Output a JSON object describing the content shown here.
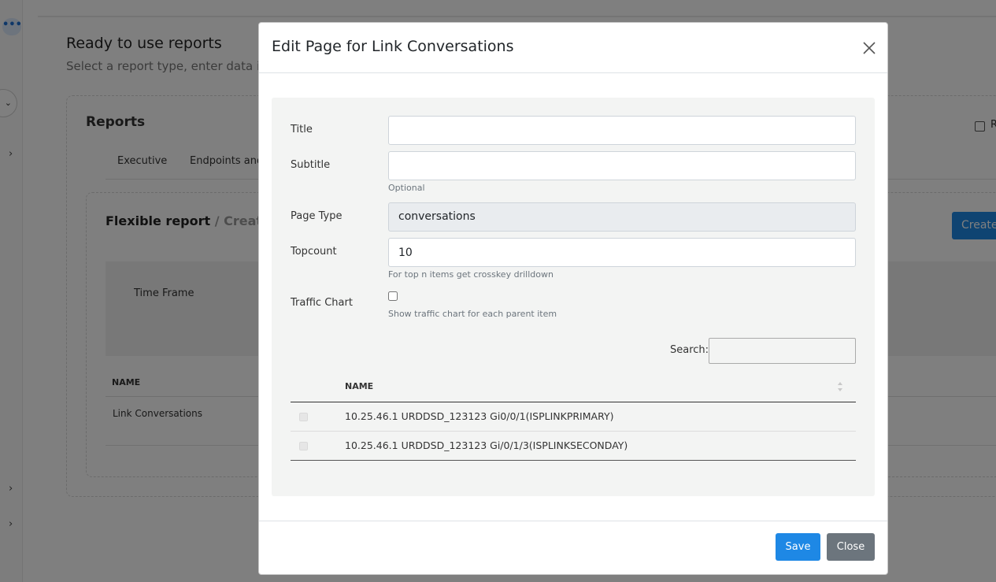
{
  "background": {
    "page_title": "Ready to use reports",
    "page_subtitle": "Select a report type, enter data if r",
    "reports_heading": "Reports",
    "reports_checkbox_label": "R",
    "tabs": [
      "Executive",
      "Endpoints and"
    ],
    "flexible_report": {
      "title": "Flexible report",
      "subtitle": " / Create y"
    },
    "create_button": "Create",
    "time_frame_label": "Time Frame",
    "table": {
      "header_name": "NAME",
      "rows": [
        "Link Conversations"
      ]
    }
  },
  "modal": {
    "title": "Edit Page for Link Conversations",
    "fields": {
      "title": {
        "label": "Title",
        "value": ""
      },
      "subtitle": {
        "label": "Subtitle",
        "value": "",
        "help": "Optional"
      },
      "page_type": {
        "label": "Page Type",
        "value": "conversations"
      },
      "topcount": {
        "label": "Topcount",
        "value": "10",
        "help": "For top n items get crosskey drilldown"
      },
      "traffic_chart": {
        "label": "Traffic Chart",
        "checked": false,
        "help": "Show traffic chart for each parent item"
      }
    },
    "search": {
      "label": "Search:",
      "value": ""
    },
    "table": {
      "header_name": "NAME",
      "rows": [
        "10.25.46.1 URDDSD_123123 Gi0/0/1(ISPLINKPRIMARY)",
        "10.25.46.1 URDDSD_123123 Gi/0/1/3(ISPLINKSECONDAY)"
      ]
    },
    "buttons": {
      "save": "Save",
      "close": "Close"
    }
  },
  "colors": {
    "primary": "#1e88e5",
    "secondary": "#6c757d",
    "backdrop": "rgba(0,0,0,0.5)"
  }
}
